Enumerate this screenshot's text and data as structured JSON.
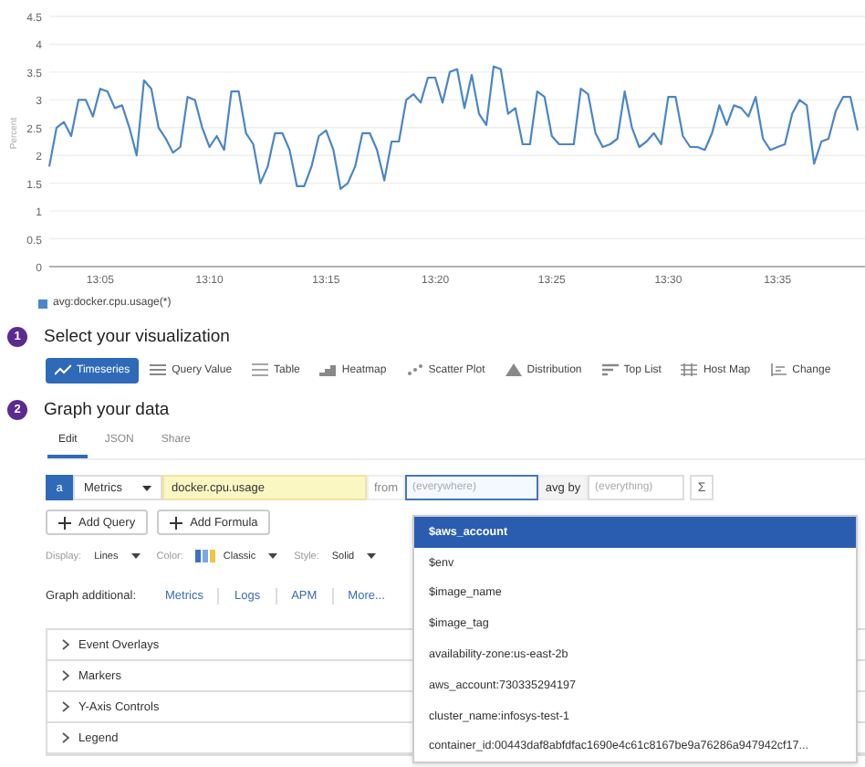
{
  "chart": {
    "chart_data": {
      "type": "line",
      "ylabel": "Percent",
      "categories": [
        null,
        null,
        null,
        null,
        null,
        null,
        null,
        "13:05",
        null,
        null,
        null,
        null,
        null,
        null,
        null,
        null,
        null,
        null,
        null,
        null,
        null,
        null,
        "13:10",
        null,
        null,
        null,
        null,
        null,
        null,
        null,
        null,
        null,
        null,
        null,
        null,
        null,
        null,
        null,
        "13:15",
        null,
        null,
        null,
        null,
        null,
        null,
        null,
        null,
        null,
        null,
        null,
        null,
        null,
        null,
        "13:20",
        null,
        null,
        null,
        null,
        null,
        null,
        null,
        null,
        null,
        null,
        null,
        null,
        null,
        null,
        null,
        "13:25",
        null,
        null,
        null,
        null,
        null,
        null,
        null,
        null,
        null,
        null,
        null,
        null,
        null,
        null,
        null,
        "13:30",
        null,
        null,
        null,
        null,
        null,
        null,
        null,
        null,
        null,
        null,
        null,
        null,
        null,
        null,
        "13:35",
        null,
        null,
        null,
        null,
        null,
        null,
        null,
        null,
        null,
        null,
        null
      ],
      "series": [
        {
          "name": "avg:docker.cpu.usage(*)",
          "color": "#4a86c8",
          "values": [
            1.8,
            2.5,
            2.6,
            2.35,
            3.0,
            3.0,
            2.7,
            3.2,
            3.15,
            2.85,
            2.9,
            2.5,
            2.0,
            3.35,
            3.2,
            2.5,
            2.3,
            2.05,
            2.15,
            3.05,
            3.0,
            2.5,
            2.15,
            2.35,
            2.1,
            3.15,
            3.15,
            2.4,
            2.2,
            1.5,
            1.8,
            2.4,
            2.4,
            2.1,
            1.45,
            1.45,
            1.8,
            2.35,
            2.45,
            2.1,
            1.4,
            1.5,
            1.8,
            2.4,
            2.4,
            2.1,
            1.55,
            2.25,
            2.25,
            3.0,
            3.1,
            2.95,
            3.4,
            3.4,
            2.95,
            3.5,
            3.55,
            2.85,
            3.45,
            2.75,
            2.55,
            3.6,
            3.55,
            2.75,
            2.85,
            2.2,
            2.2,
            3.15,
            3.05,
            2.35,
            2.2,
            2.2,
            2.2,
            3.2,
            3.1,
            2.4,
            2.15,
            2.2,
            2.3,
            3.15,
            2.5,
            2.15,
            2.25,
            2.4,
            2.2,
            3.05,
            3.05,
            2.35,
            2.15,
            2.15,
            2.1,
            2.4,
            2.9,
            2.55,
            2.9,
            2.85,
            2.7,
            3.05,
            2.3,
            2.1,
            2.15,
            2.2,
            2.75,
            3.0,
            2.9,
            1.85,
            2.25,
            2.3,
            2.8,
            3.05,
            3.05,
            2.45
          ]
        }
      ],
      "ylim": [
        0,
        4.5
      ],
      "grid": true,
      "yticks": [
        0,
        0.5,
        1,
        1.5,
        2,
        2.5,
        3,
        3.5,
        4,
        4.5
      ]
    }
  },
  "steps": [
    {
      "number": "1",
      "title": "Select your visualization"
    },
    {
      "number": "2",
      "title": "Graph your data"
    }
  ],
  "visualizations": [
    {
      "label": "Timeseries",
      "kind": "line",
      "selected": true
    },
    {
      "label": "Query Value",
      "kind": "value",
      "selected": false
    },
    {
      "label": "Table",
      "kind": "table",
      "selected": false
    },
    {
      "label": "Heatmap",
      "kind": "heatmap",
      "selected": false
    },
    {
      "label": "Scatter Plot",
      "kind": "scatter",
      "selected": false
    },
    {
      "label": "Distribution",
      "kind": "distribution",
      "selected": false
    },
    {
      "label": "Top List",
      "kind": "toplist",
      "selected": false
    },
    {
      "label": "Host Map",
      "kind": "hostmap",
      "selected": false
    },
    {
      "label": "Change",
      "kind": "change",
      "selected": false
    }
  ],
  "editor_tabs": [
    {
      "label": "Edit",
      "selected": true
    },
    {
      "label": "JSON",
      "selected": false
    },
    {
      "label": "Share",
      "selected": false
    }
  ],
  "query": {
    "letter": "a",
    "source": "Metrics",
    "metric": "docker.cpu.usage",
    "from_label": "from",
    "from_placeholder": "(everywhere)",
    "avg_by_label": "avg by",
    "avg_by_placeholder": "(everything)",
    "sigma": "Σ"
  },
  "tag_dropdown": [
    {
      "label": "$aws_account",
      "selected": true
    },
    {
      "label": "$env",
      "selected": false
    },
    {
      "label": "$image_name",
      "selected": false
    },
    {
      "label": "$image_tag",
      "selected": false
    },
    {
      "label": "availability-zone:us-east-2b",
      "selected": false
    },
    {
      "label": "aws_account:730335294197",
      "selected": false
    },
    {
      "label": "cluster_name:infosys-test-1",
      "selected": false
    },
    {
      "label": "container_id:00443daf8abfdfac1690e4c61c8167be9a76286a947942cf17...",
      "selected": false
    }
  ],
  "add_buttons": [
    "Add Query",
    "Add Formula"
  ],
  "display_options": [
    {
      "label": "Display:",
      "value": "Lines"
    },
    {
      "label": "Color:",
      "value": "Classic",
      "swatch": true
    },
    {
      "label": "Style:",
      "value": "Solid"
    }
  ],
  "graph_additional": {
    "label": "Graph additional:",
    "links": [
      "Metrics",
      "Logs",
      "APM",
      "More..."
    ]
  },
  "sections": [
    {
      "label": "Event Overlays",
      "expanded": false
    },
    {
      "label": "Markers",
      "expanded": false
    },
    {
      "label": "Y-Axis Controls",
      "expanded": false
    },
    {
      "label": "Legend",
      "expanded": false
    }
  ]
}
